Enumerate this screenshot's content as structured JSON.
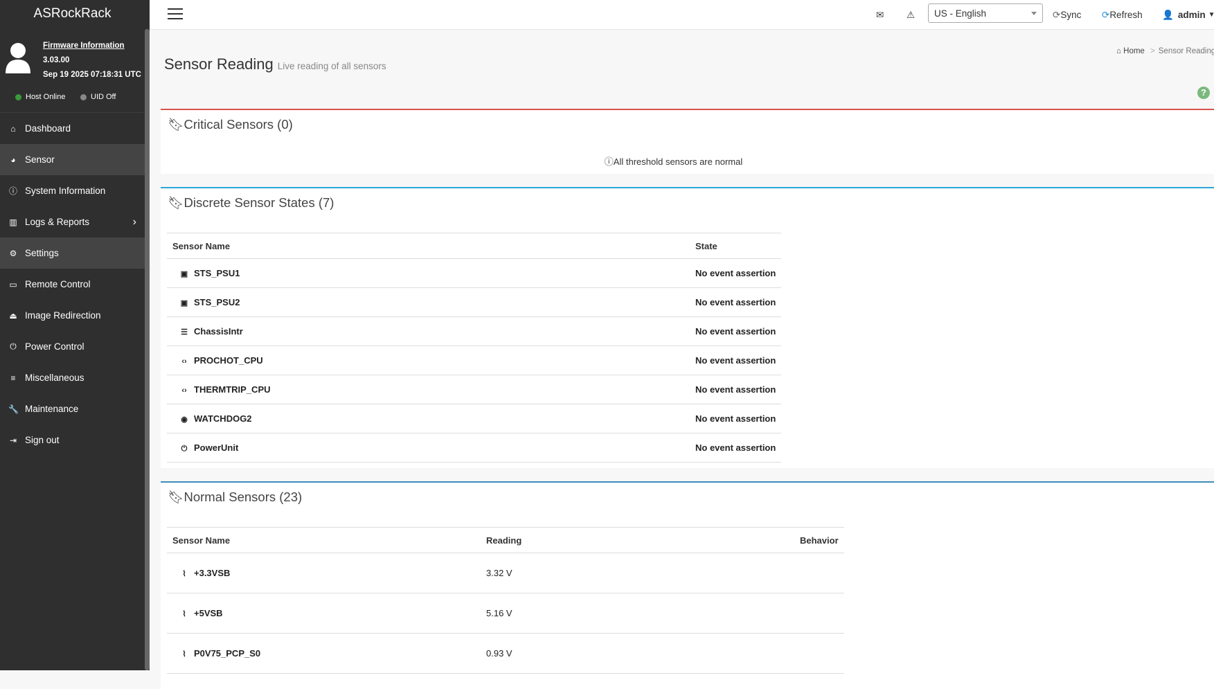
{
  "brand": "ASRockRack",
  "firmware": {
    "title": "Firmware Information",
    "version": "3.03.00",
    "date": "Sep 19 2025 07:18:31 UTC"
  },
  "status": {
    "host": "Host Online",
    "uid": "UID Off",
    "host_color": "#3a9a3a",
    "uid_color": "#888888"
  },
  "nav": [
    {
      "label": "Dashboard",
      "icon": "home-icon",
      "glyph": "⌂"
    },
    {
      "label": "Sensor",
      "icon": "gauge-icon",
      "glyph": "◕",
      "active": true
    },
    {
      "label": "System Information",
      "icon": "info-icon",
      "glyph": "ⓘ"
    },
    {
      "label": "Logs & Reports",
      "icon": "bar-chart-icon",
      "glyph": "▥",
      "sub": true
    },
    {
      "label": "Settings",
      "icon": "gear-icon",
      "glyph": "⚙",
      "active": true
    },
    {
      "label": "Remote Control",
      "icon": "monitor-icon",
      "glyph": "▭"
    },
    {
      "label": "Image Redirection",
      "icon": "drive-icon",
      "glyph": "⏏"
    },
    {
      "label": "Power Control",
      "icon": "power-icon",
      "glyph": "⏻"
    },
    {
      "label": "Miscellaneous",
      "icon": "list-icon",
      "glyph": "≡"
    },
    {
      "label": "Maintenance",
      "icon": "wrench-icon",
      "glyph": "🔧"
    },
    {
      "label": "Sign out",
      "icon": "sign-out-icon",
      "glyph": "⇥"
    }
  ],
  "header": {
    "language": "US - English",
    "sync": "Sync",
    "refresh": "Refresh",
    "user": "admin"
  },
  "page": {
    "title": "Sensor Reading",
    "subtitle": "Live reading of all sensors",
    "breadcrumb_home": "Home",
    "breadcrumb_current": "Sensor Reading"
  },
  "critical": {
    "title": "Critical Sensors (0)",
    "message": "All threshold sensors are normal",
    "color": "#d9534f"
  },
  "discrete": {
    "title": "Discrete Sensor States (7)",
    "color": "#2aa7d6",
    "columns": [
      "Sensor Name",
      "State"
    ],
    "rows": [
      [
        "STS_PSU1",
        "No event assertion",
        "▣"
      ],
      [
        "STS_PSU2",
        "No event assertion",
        "▣"
      ],
      [
        "ChassisIntr",
        "No event assertion",
        "☰"
      ],
      [
        "PROCHOT_CPU",
        "No event assertion",
        "‹›"
      ],
      [
        "THERMTRIP_CPU",
        "No event assertion",
        "‹›"
      ],
      [
        "WATCHDOG2",
        "No event assertion",
        "◉"
      ],
      [
        "PowerUnit",
        "No event assertion",
        "⏻"
      ]
    ]
  },
  "normal": {
    "title": "Normal Sensors (23)",
    "color": "#3c8dbc",
    "columns": [
      "Sensor Name",
      "Reading",
      "Behavior"
    ],
    "rows": [
      [
        "+3.3VSB",
        "3.32 V",
        ""
      ],
      [
        "+5VSB",
        "5.16 V",
        ""
      ],
      [
        "P0V75_PCP_S0",
        "0.93 V",
        ""
      ]
    ]
  }
}
